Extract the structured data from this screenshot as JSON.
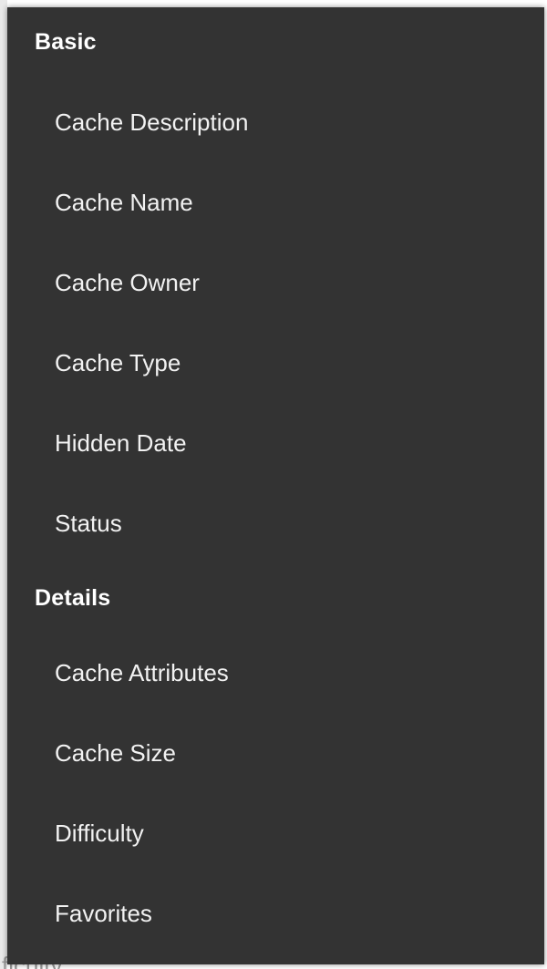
{
  "backdrop": {
    "partial_text": "ficulty"
  },
  "menu": {
    "sections": [
      {
        "header": "Basic",
        "items": [
          "Cache Description",
          "Cache Name",
          "Cache Owner",
          "Cache Type",
          "Hidden Date",
          "Status"
        ]
      },
      {
        "header": "Details",
        "items": [
          "Cache Attributes",
          "Cache Size",
          "Difficulty",
          "Favorites"
        ]
      }
    ]
  },
  "colors": {
    "menu_background": "#333333",
    "header_text": "#ffffff",
    "item_text": "#f2f2f2"
  }
}
